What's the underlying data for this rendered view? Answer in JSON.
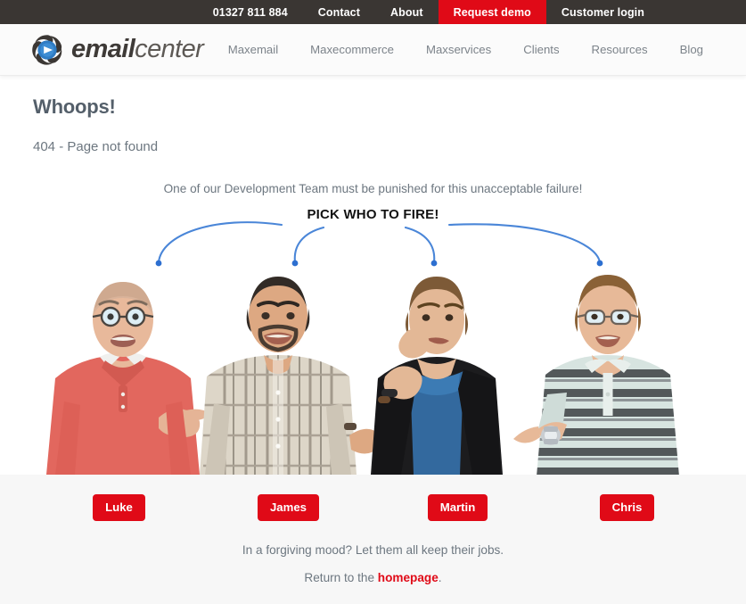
{
  "topbar": {
    "phone": "01327 811 884",
    "items": [
      {
        "label": "Contact",
        "style": "plain"
      },
      {
        "label": "About",
        "style": "plain"
      },
      {
        "label": "Request demo",
        "style": "cta"
      },
      {
        "label": "Customer login",
        "style": "plain"
      }
    ]
  },
  "header": {
    "logo": {
      "icon": "emailcenter-aperture-logo",
      "bold_part": "email",
      "light_part": "center"
    },
    "nav": [
      {
        "label": "Maxemail"
      },
      {
        "label": "Maxecommerce"
      },
      {
        "label": "Maxservices"
      },
      {
        "label": "Clients"
      },
      {
        "label": "Resources"
      },
      {
        "label": "Blog"
      }
    ]
  },
  "page": {
    "title": "Whoops!",
    "subtitle": "404 - Page not found"
  },
  "punish": {
    "lead": "One of our Development Team must be punished for this unacceptable failure!",
    "pick_label": "PICK WHO TO FIRE!",
    "people": [
      {
        "name": "Luke",
        "description": "bald man with glasses in coral polo shirt pointing right"
      },
      {
        "name": "James",
        "description": "man with goatee in beige plaid short sleeve shirt"
      },
      {
        "name": "Martin",
        "description": "young man in black blazer over blue t-shirt biting nails"
      },
      {
        "name": "Chris",
        "description": "man with glasses in grey striped polo shirt pointing left"
      }
    ]
  },
  "footer": {
    "forgive": "In a forgiving mood? Let them all keep their jobs.",
    "return_prefix": "Return to the ",
    "homepage_link": "homepage",
    "return_suffix": "."
  },
  "colors": {
    "brand_red": "#e00a17",
    "topbar_dark": "#3a3633",
    "arrow_blue": "#4a86d8",
    "body_text": "#6d7780",
    "panel_grey": "#f7f7f7"
  }
}
